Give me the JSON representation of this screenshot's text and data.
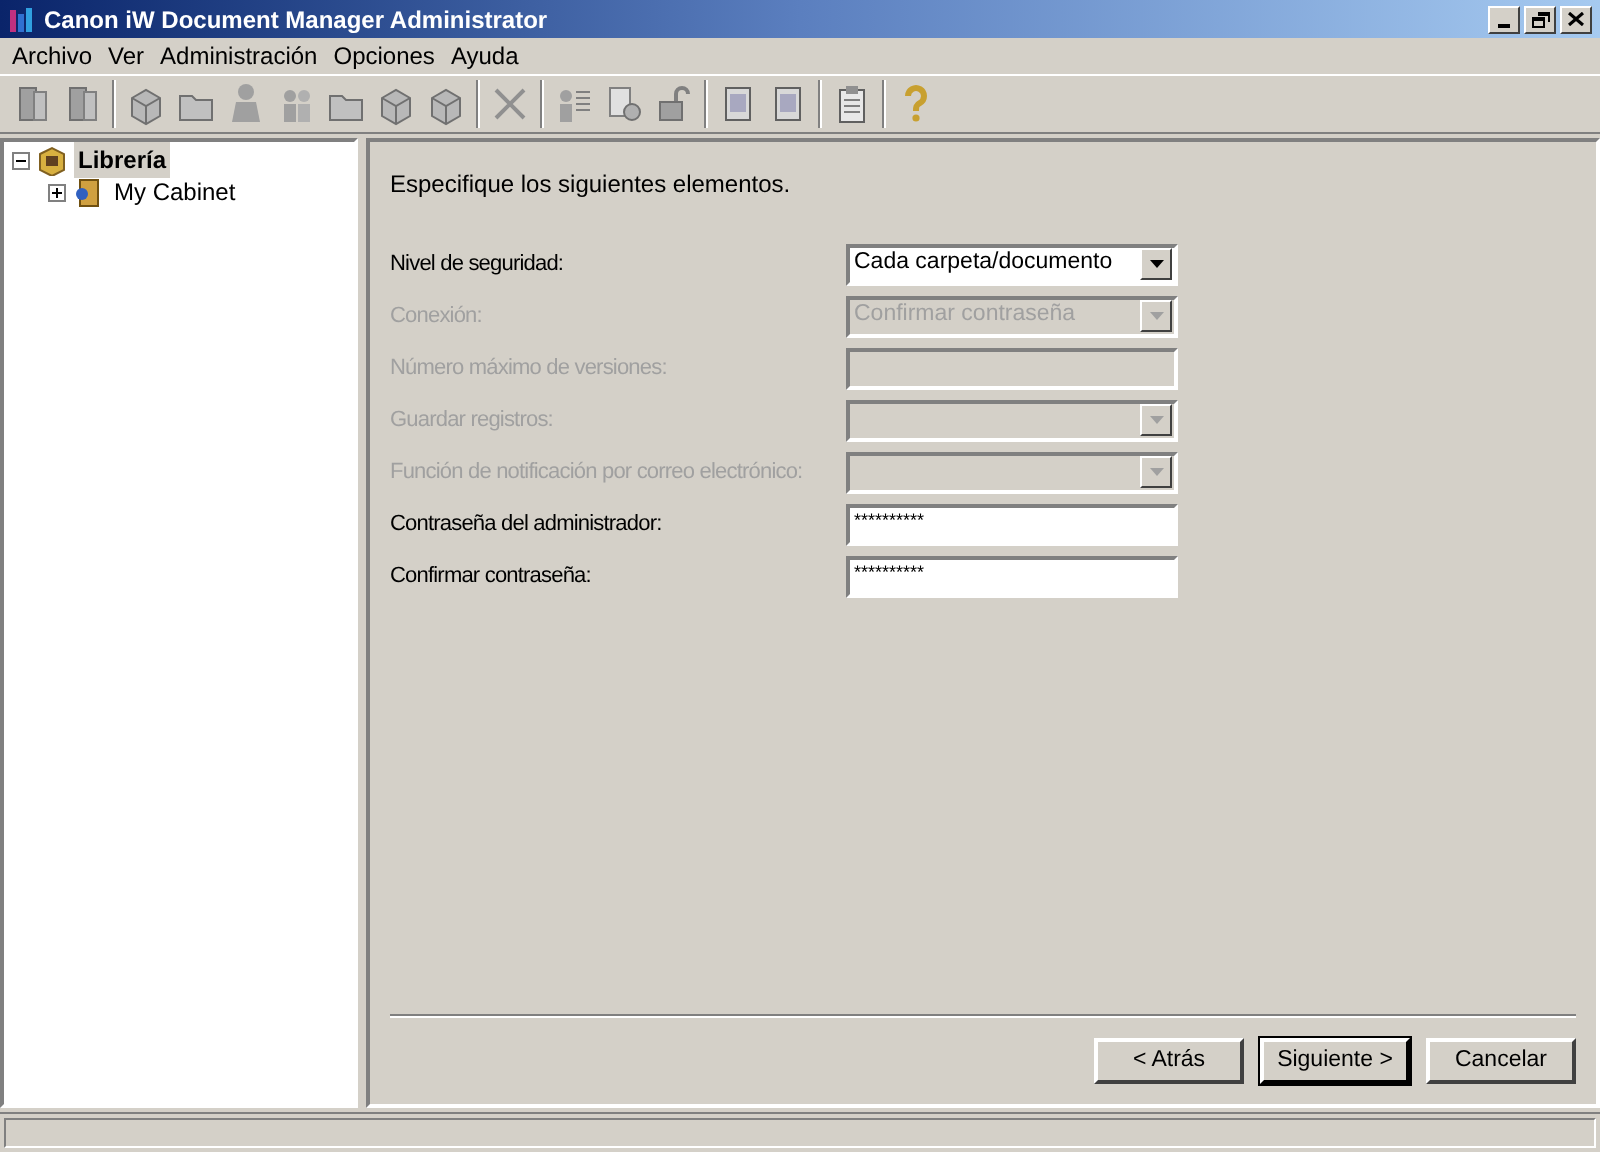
{
  "window": {
    "title": "Canon iW Document Manager Administrator"
  },
  "menu": [
    "Archivo",
    "Ver",
    "Administración",
    "Opciones",
    "Ayuda"
  ],
  "tree": [
    {
      "label": "Librería",
      "expanded": true,
      "selected": true,
      "children": [
        {
          "label": "My Cabinet",
          "expanded": false,
          "selected": false
        }
      ]
    }
  ],
  "instructions": "Especifique los siguientes elementos.",
  "fields": [
    {
      "label": "Nivel de seguridad:",
      "kind": "combo",
      "disabled": false,
      "value": "Cada carpeta/documento"
    },
    {
      "label": "Conexión:",
      "kind": "combo",
      "disabled": true,
      "value": "Confirmar contraseña"
    },
    {
      "label": "Número máximo de versiones:",
      "kind": "text",
      "disabled": true
    },
    {
      "label": "Guardar registros:",
      "kind": "combo",
      "disabled": true
    },
    {
      "label": "Función de notificación por correo electrónico:",
      "kind": "combo",
      "disabled": true
    },
    {
      "label": "Contraseña del administrador:",
      "kind": "text",
      "disabled": false,
      "value": "**********"
    },
    {
      "label": "Confirmar contraseña:",
      "kind": "text",
      "disabled": false,
      "value": "**********"
    }
  ],
  "buttons": [
    {
      "label": "< Atrás",
      "default": false
    },
    {
      "label": "Siguiente >",
      "default": true
    },
    {
      "label": "Cancelar",
      "default": false
    }
  ]
}
